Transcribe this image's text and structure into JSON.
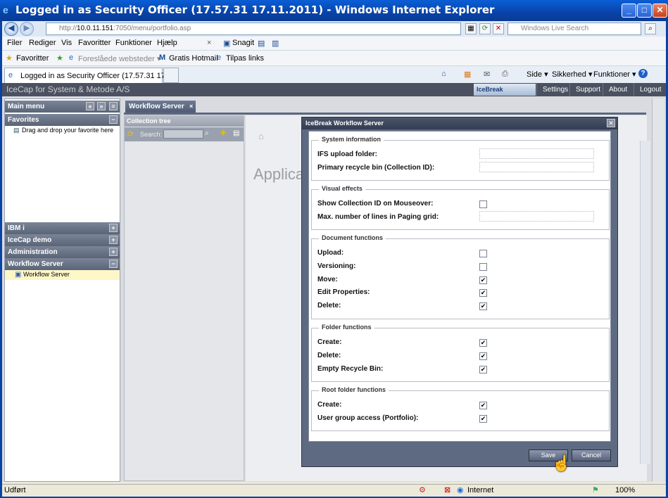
{
  "window": {
    "title": "Logged in as Security Officer (17.57.31 17.11.2011) - Windows Internet Explorer",
    "minimize": "_",
    "maximize": "□",
    "close": "✕"
  },
  "browser": {
    "address_prefix": "http://",
    "address_host": "10.0.11.151",
    "address_path": ":7050/menu/portfolio.asp",
    "search_placeholder": "Windows Live Search",
    "menu": [
      "Filer",
      "Rediger",
      "Vis",
      "Favoritter",
      "Funktioner",
      "Hjælp"
    ],
    "menu_close": "×",
    "snagit": "Snagit",
    "favorites_label": "Favoritter",
    "fav_links": [
      "Foreslåede websteder ▾",
      "Gratis Hotmail",
      "Tilpas links"
    ],
    "tab_title": "Logged in as Security Officer (17.57.31 17.1...",
    "commands": [
      "Side ▾",
      "Sikkerhed ▾",
      "Funktioner ▾"
    ],
    "help_icon": "?"
  },
  "app": {
    "brand": "IceCap for System & Metode A/S",
    "logo": "IceBreak",
    "header_links": [
      "Settings",
      "Support",
      "About",
      "Logout"
    ]
  },
  "left_panel": {
    "main_menu": "Main menu",
    "favorites": "Favorites",
    "favorites_hint": "Drag and drop your favorite here",
    "sections": [
      "IBM i",
      "IceCap demo",
      "Administration",
      "Workflow Server"
    ],
    "workflow_item": "Workflow Server"
  },
  "workflow": {
    "tab_label": "Workflow Server",
    "tab_close": "×",
    "collection_tree": "Collection tree",
    "search_label": "Search:",
    "bg_heading": "Applica"
  },
  "dialog": {
    "title": "IceBreak Workflow Server",
    "close": "✕",
    "sections": {
      "system": {
        "legend": "System information",
        "fields": [
          "IFS upload folder:",
          "Primary recycle bin (Collection ID):"
        ],
        "values": [
          "",
          ""
        ]
      },
      "visual": {
        "legend": "Visual effects",
        "checkbox_label": "Show Collection ID on Mouseover:",
        "checkbox_checked": false,
        "field_label": "Max. number of lines in Paging grid:",
        "field_value": ""
      },
      "document": {
        "legend": "Document functions",
        "items": [
          {
            "label": "Upload:",
            "checked": false
          },
          {
            "label": "Versioning:",
            "checked": false
          },
          {
            "label": "Move:",
            "checked": true
          },
          {
            "label": "Edit Properties:",
            "checked": true
          },
          {
            "label": "Delete:",
            "checked": true
          }
        ]
      },
      "folder": {
        "legend": "Folder functions",
        "items": [
          {
            "label": "Create:",
            "checked": true
          },
          {
            "label": "Delete:",
            "checked": true
          },
          {
            "label": "Empty Recycle Bin:",
            "checked": true
          }
        ]
      },
      "root": {
        "legend": "Root folder functions",
        "items": [
          {
            "label": "Create:",
            "checked": true
          },
          {
            "label": "User group access (Portfolio):",
            "checked": true
          }
        ]
      }
    },
    "save": "Save",
    "cancel": "Cancel"
  },
  "status": {
    "left": "Udført",
    "zone": "Internet",
    "zoom": "100%"
  }
}
